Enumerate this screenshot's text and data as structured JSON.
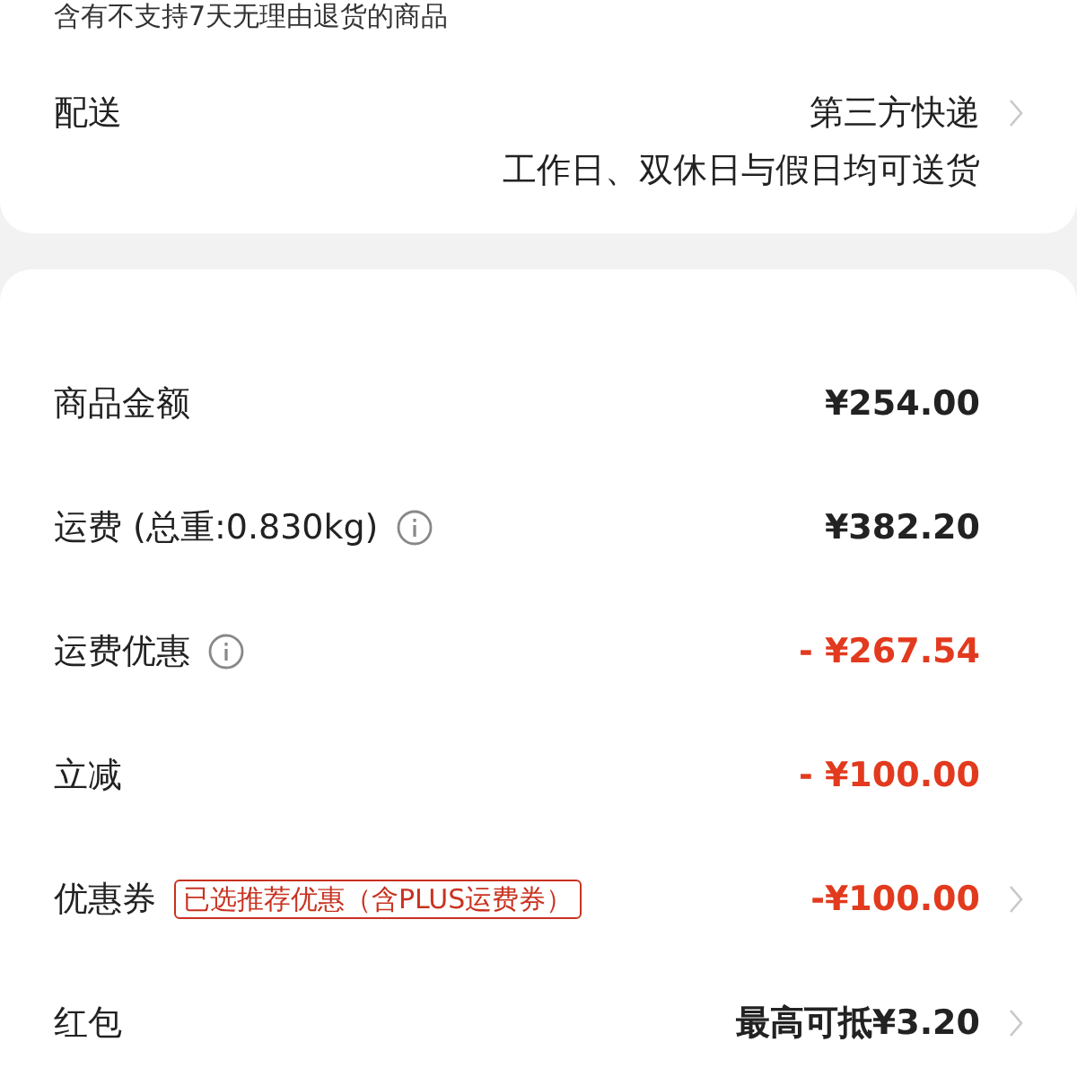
{
  "notice": "含有不支持7天无理由退货的商品",
  "delivery": {
    "label": "配送",
    "method": "第三方快递",
    "note": "工作日、双休日与假日均可送货",
    "chevron": true
  },
  "rows": [
    {
      "label": "商品金额",
      "info": false,
      "value": "¥254.00",
      "discount": false,
      "chevron": false
    },
    {
      "label": "运费 (总重:0.830kg)",
      "info": true,
      "value": "¥382.20",
      "discount": false,
      "chevron": false
    },
    {
      "label": "运费优惠",
      "info": true,
      "value": "- ¥267.54",
      "discount": true,
      "chevron": false
    },
    {
      "label": "立减",
      "info": false,
      "value": "- ¥100.00",
      "discount": true,
      "chevron": false
    },
    {
      "label": "优惠券",
      "info": false,
      "tag": "已选推荐优惠（含PLUS运费券）",
      "value": "-¥100.00",
      "discount": true,
      "chevron": true
    },
    {
      "label": "红包",
      "info": false,
      "value": "最高可抵¥3.20",
      "discount": false,
      "chevron": true
    }
  ]
}
